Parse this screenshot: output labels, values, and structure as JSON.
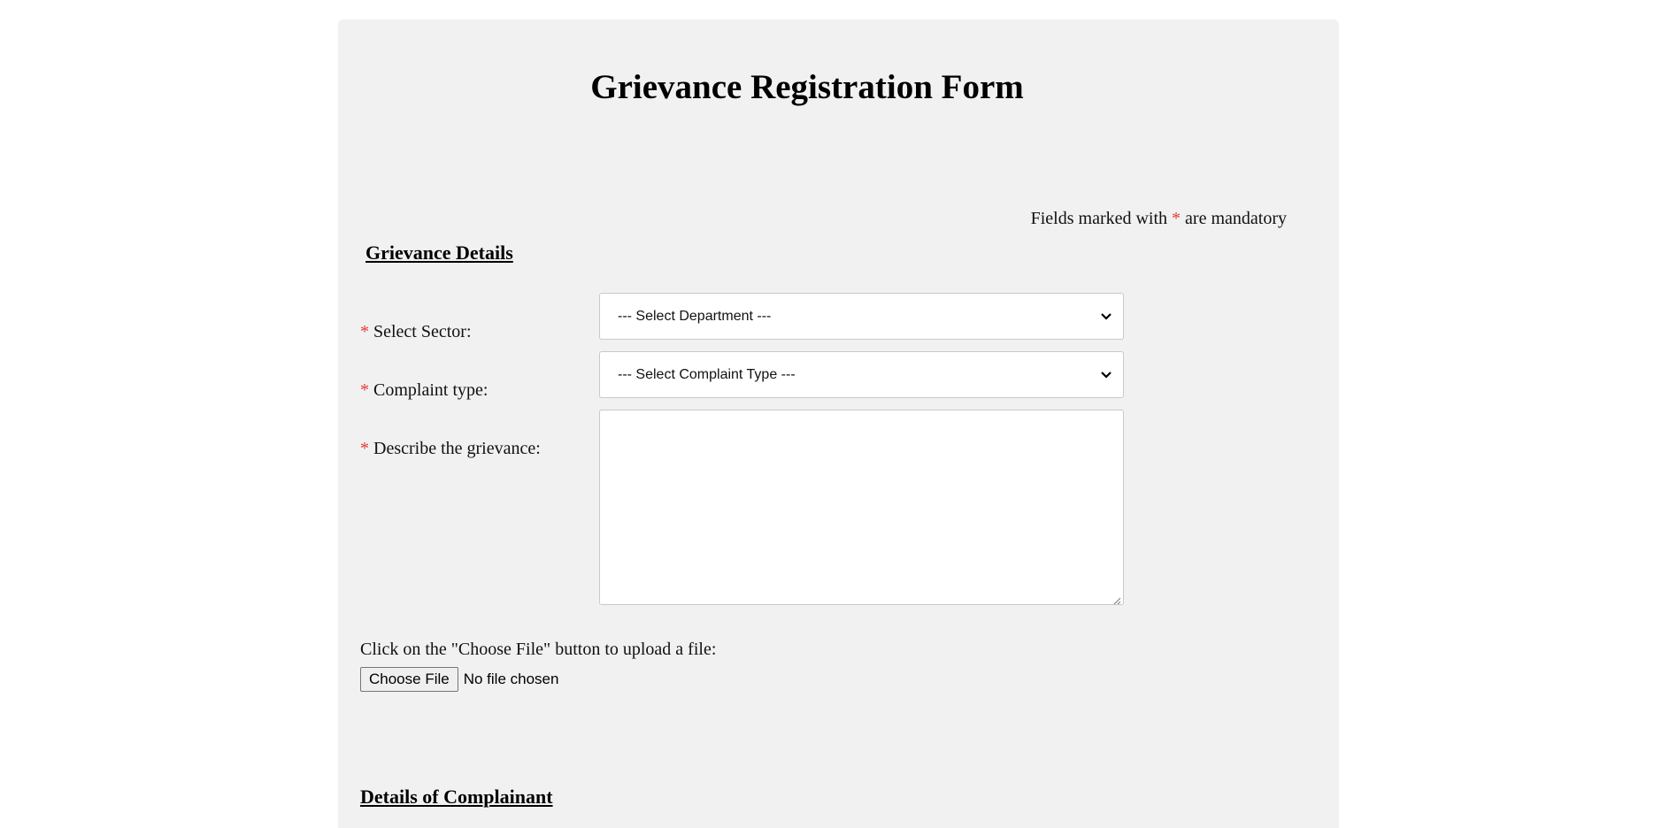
{
  "page": {
    "title": "Grievance Registration Form",
    "mandatory_note_prefix": "Fields marked with ",
    "mandatory_marker": "*",
    "mandatory_note_suffix": " are mandatory",
    "required_marker_color": "#e53935"
  },
  "grievance_details": {
    "heading": "Grievance Details",
    "fields": {
      "sector": {
        "label": " Select Sector:",
        "selected": "--- Select Department ---",
        "icon": "chevron-down-icon"
      },
      "complaint_type": {
        "label": " Complaint type:",
        "selected": "--- Select Complaint Type ---",
        "icon": "chevron-down-icon"
      },
      "description": {
        "label": " Describe the grievance:",
        "value": ""
      }
    },
    "upload": {
      "instruction": "Click on the \"Choose File\" button to upload a file:",
      "button_label": "Choose File",
      "status": "No file chosen"
    }
  },
  "complainant_details": {
    "heading": "Details of Complainant"
  }
}
